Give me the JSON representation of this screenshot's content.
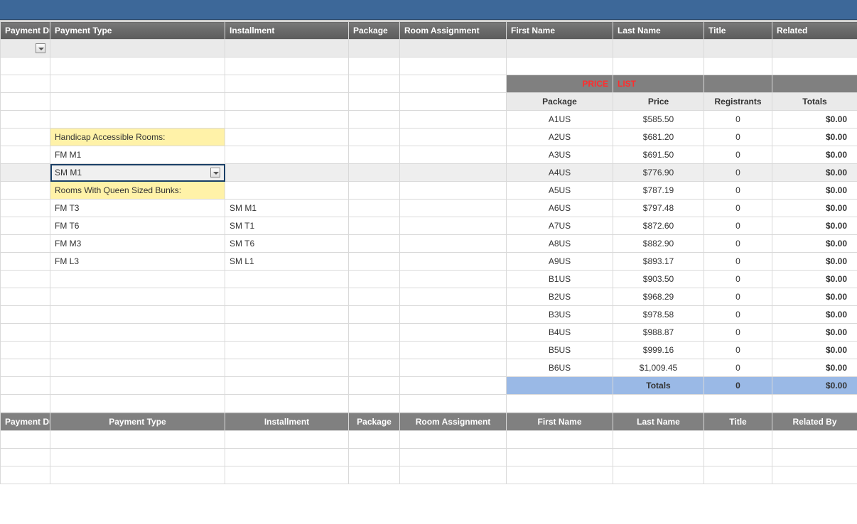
{
  "headers": {
    "payment_due": "Payment Due",
    "payment_type": "Payment Type",
    "installment": "Installment",
    "package": "Package",
    "room_assignment": "Room Assignment",
    "first_name": "First Name",
    "last_name": "Last Name",
    "title": "Title",
    "related": "Related"
  },
  "lower_headers": {
    "payment_due": "Payment Due",
    "payment_type": "Payment Type",
    "installment": "Installment",
    "package": "Package",
    "room_assignment": "Room Assignment",
    "first_name": "First Name",
    "last_name": "Last Name",
    "title": "Title",
    "related_by": "Related By"
  },
  "left_rows": {
    "r0": {
      "type": "",
      "inst": ""
    },
    "r1": {
      "type": "",
      "inst": ""
    },
    "r2": {
      "type": "",
      "inst": ""
    },
    "r3": {
      "type": "",
      "inst": ""
    },
    "r4": {
      "type": "Handicap Accessible Rooms:",
      "inst": ""
    },
    "r5": {
      "type": "FM M1",
      "inst": ""
    },
    "r6": {
      "type": "SM M1",
      "inst": ""
    },
    "r7": {
      "type": "Rooms With Queen Sized Bunks:",
      "inst": ""
    },
    "r8": {
      "type": "FM T3",
      "inst": "SM M1"
    },
    "r9": {
      "type": "FM T6",
      "inst": "SM T1"
    },
    "r10": {
      "type": "FM M3",
      "inst": "SM T6"
    },
    "r11": {
      "type": "FM L3",
      "inst": "SM L1"
    }
  },
  "price_list": {
    "band_left": "PRICE",
    "band_right": "LIST",
    "sub": {
      "package": "Package",
      "price": "Price",
      "registrants": "Registrants",
      "totals": "Totals"
    },
    "rows": [
      {
        "pkg": "A1US",
        "price": "$585.50",
        "reg": "0",
        "tot": "$0.00"
      },
      {
        "pkg": "A2US",
        "price": "$681.20",
        "reg": "0",
        "tot": "$0.00"
      },
      {
        "pkg": "A3US",
        "price": "$691.50",
        "reg": "0",
        "tot": "$0.00"
      },
      {
        "pkg": "A4US",
        "price": "$776.90",
        "reg": "0",
        "tot": "$0.00"
      },
      {
        "pkg": "A5US",
        "price": "$787.19",
        "reg": "0",
        "tot": "$0.00"
      },
      {
        "pkg": "A6US",
        "price": "$797.48",
        "reg": "0",
        "tot": "$0.00"
      },
      {
        "pkg": "A7US",
        "price": "$872.60",
        "reg": "0",
        "tot": "$0.00"
      },
      {
        "pkg": "A8US",
        "price": "$882.90",
        "reg": "0",
        "tot": "$0.00"
      },
      {
        "pkg": "A9US",
        "price": "$893.17",
        "reg": "0",
        "tot": "$0.00"
      },
      {
        "pkg": "B1US",
        "price": "$903.50",
        "reg": "0",
        "tot": "$0.00"
      },
      {
        "pkg": "B2US",
        "price": "$968.29",
        "reg": "0",
        "tot": "$0.00"
      },
      {
        "pkg": "B3US",
        "price": "$978.58",
        "reg": "0",
        "tot": "$0.00"
      },
      {
        "pkg": "B4US",
        "price": "$988.87",
        "reg": "0",
        "tot": "$0.00"
      },
      {
        "pkg": "B5US",
        "price": "$999.16",
        "reg": "0",
        "tot": "$0.00"
      },
      {
        "pkg": "B6US",
        "price": "$1,009.45",
        "reg": "0",
        "tot": "$0.00"
      }
    ],
    "totals_row": {
      "label": "Totals",
      "reg": "0",
      "tot": "$0.00"
    }
  }
}
